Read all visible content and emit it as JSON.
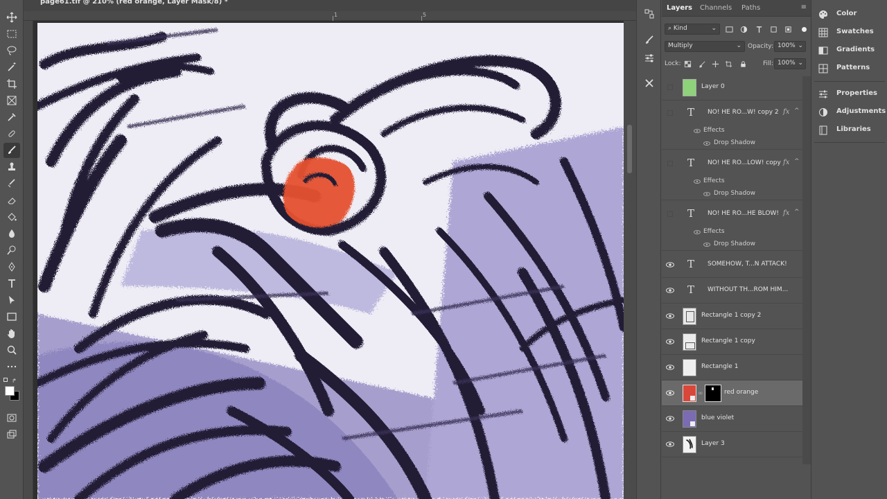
{
  "document": {
    "tab_title": "page61.tif @ 210% (red orange, Layer Mask/8) *"
  },
  "ruler": {
    "labels": [
      "1",
      "5"
    ]
  },
  "layers_panel": {
    "tabs": [
      "Layers",
      "Channels",
      "Paths"
    ],
    "filter_kind": "Kind",
    "blend_mode": "Multiply",
    "opacity_label": "Opacity:",
    "opacity_value": "100%",
    "lock_label": "Lock:",
    "fill_label": "Fill:",
    "fill_value": "100%",
    "effects_label": "Effects",
    "drop_shadow_label": "Drop Shadow",
    "fx_symbol": "fx",
    "layers": [
      {
        "name": "Layer 0",
        "type": "pixel",
        "visible": false,
        "thumb_color": "#8ed27a"
      },
      {
        "name": "NO! HE RO...W! copy 2",
        "type": "text",
        "visible": false,
        "has_fx": true
      },
      {
        "name": "NO! HE RO...LOW! copy",
        "type": "text",
        "visible": false,
        "has_fx": true
      },
      {
        "name": "NO! HE RO...HE BLOW!",
        "type": "text",
        "visible": false,
        "has_fx": true
      },
      {
        "name": "SOMEHOW, T...N ATTACK!",
        "type": "text",
        "visible": true
      },
      {
        "name": "WITHOUT TH...ROM HIM...",
        "type": "text",
        "visible": true
      },
      {
        "name": "Rectangle 1 copy 2",
        "type": "shape",
        "visible": true
      },
      {
        "name": "Rectangle 1 copy",
        "type": "shape",
        "visible": true
      },
      {
        "name": "Rectangle 1",
        "type": "shape",
        "visible": true
      },
      {
        "name": "red orange",
        "type": "fill",
        "visible": true,
        "selected": true,
        "thumb_color": "#d9473a"
      },
      {
        "name": "blue violet",
        "type": "fill",
        "visible": true,
        "thumb_color": "#7a6bb3"
      },
      {
        "name": "Layer 3",
        "type": "pixel",
        "visible": true
      }
    ]
  },
  "right_panels": {
    "group1": [
      "Color",
      "Swatches",
      "Gradients",
      "Patterns"
    ],
    "group2": [
      "Properties",
      "Adjustments",
      "Libraries"
    ]
  },
  "colors": {
    "ui_bg": "#535353",
    "selected_row": "#6a6a6a",
    "accent_red": "#d9473a",
    "accent_violet": "#7a6bb3",
    "crayon_dark": "#2a2640"
  }
}
